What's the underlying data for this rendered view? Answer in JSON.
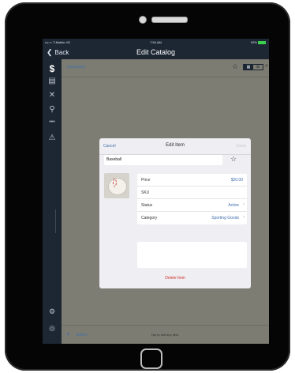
{
  "status_bar": {
    "carrier": "•••○○ T-Mobile 4G",
    "time": "7:54 AM",
    "battery": "92%"
  },
  "nav": {
    "back_label": "Back",
    "title": "Edit Catalog"
  },
  "catalog_header": {
    "categories_label": "Categories"
  },
  "bottom_bar": {
    "select_label": "Select",
    "hint": "Tap to edit any item."
  },
  "modal": {
    "cancel_label": "Cancel",
    "title": "Edit Item",
    "done_label": "Done",
    "item_name": "Baseball",
    "rows": [
      {
        "label": "Price",
        "value": "$20.00"
      },
      {
        "label": "SKU",
        "value": ""
      },
      {
        "label": "Status",
        "value": "Active"
      },
      {
        "label": "Category",
        "value": "Sporting Goods"
      }
    ],
    "delete_label": "Delete Item"
  },
  "icons": [
    "dollar-icon",
    "register-icon",
    "tools-icon",
    "location-pin-icon",
    "more-icon",
    "warning-icon",
    "gear-icon",
    "help-icon",
    "star-icon",
    "grid-view-icon",
    "list-view-icon",
    "search-icon",
    "plus-icon",
    "chevron-right-icon",
    "back-chevron-icon"
  ],
  "colors": {
    "accent": "#3f6faa",
    "danger": "#d0312d",
    "sidebar": "#1d2733",
    "dim_overlay": "#7e7d73"
  }
}
